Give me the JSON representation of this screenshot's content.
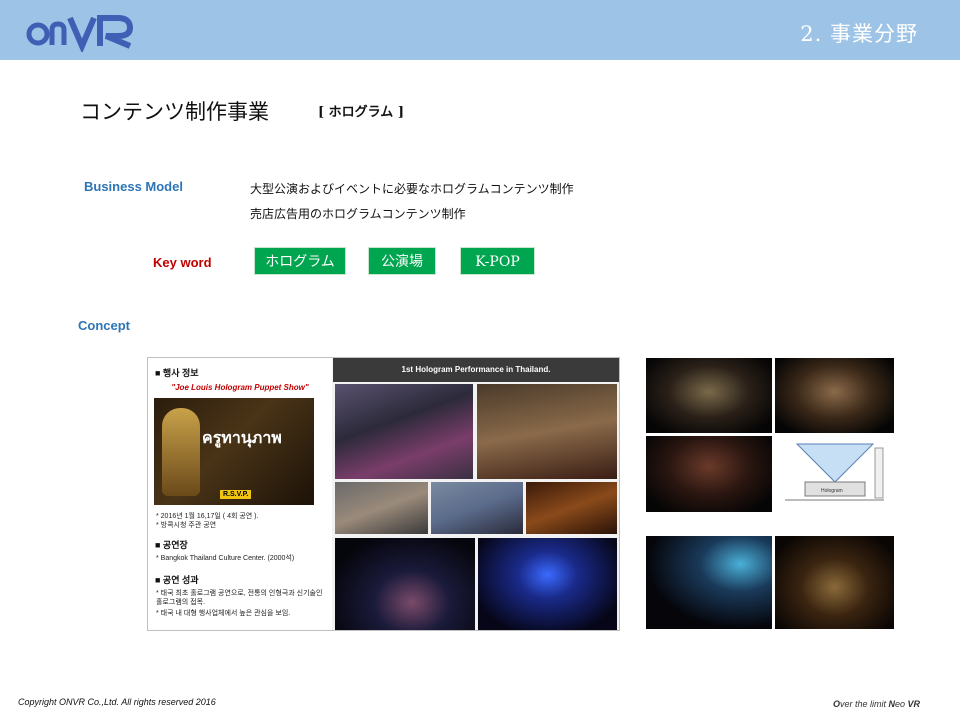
{
  "header": {
    "logo_text": "OnVR",
    "section_title": "2. 事業分野",
    "colors": {
      "band": "#9dc3e6",
      "logo": "#3f5fb5"
    }
  },
  "page": {
    "title": "コンテンツ制作事業",
    "tag": "[ ホログラム ]"
  },
  "business_model": {
    "label": "Business Model",
    "lines": [
      "大型公演およびイベントに必要なホログラムコンテンツ制作",
      "売店広告用のホログラムコンテンツ制作"
    ]
  },
  "keywords": {
    "label": "Key word",
    "items": [
      "ホログラム",
      "公演場",
      "K-POP"
    ],
    "color": "#00a54f"
  },
  "concept": {
    "label": "Concept",
    "poster": {
      "event_info_heading": "■ 행사 정보",
      "show_title": "\"Joe Louis Hologram Puppet Show\"",
      "thumb_title": "ครูทานุภาพ",
      "rsvp": "R.S.V.P.",
      "date_line": "* 2016년 1월 16,17일 ( 4회 공연 ).",
      "host_line": "* 방콕시청 주관 공연",
      "venue_heading": "■ 공연장",
      "venue_line": "* Bangkok Thailand Culture Center. (2000석)",
      "result_heading": "■ 공연 성과",
      "result_line1": "* 태국 최초 홀로그램 공연으로, 전통의 인형극과 신기술인 홀로그램의 접목.",
      "result_line2": "* 태국 내 대형 행사업체에서 높은 관심을 보임.",
      "banner": "1st Hologram Performance in Thailand."
    },
    "gallery_label": "Hologram"
  },
  "footer": {
    "copyright": "Copyright  ONVR Co.,Ltd. All rights reserved 2016",
    "slogan_parts": [
      "O",
      "ver the limit ",
      "N",
      "eo ",
      "VR"
    ]
  }
}
